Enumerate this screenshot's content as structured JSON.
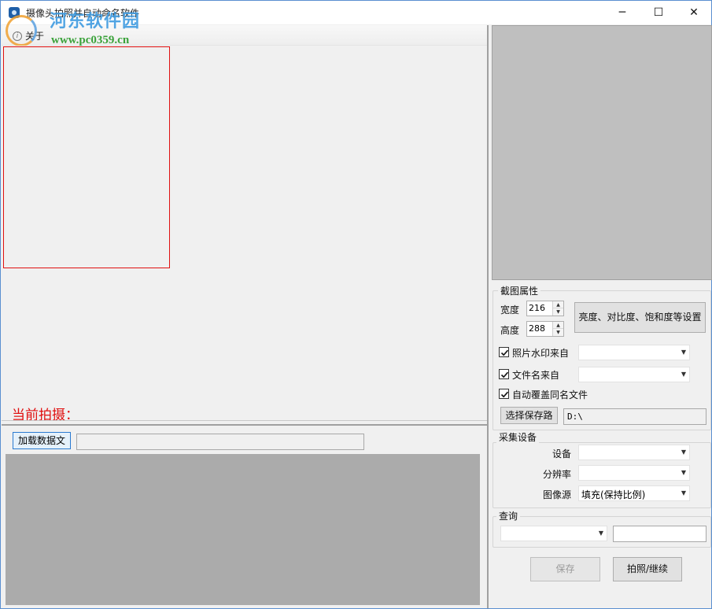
{
  "window": {
    "title": "摄像头拍照并自动命名软件",
    "controls": {
      "minimize": "─",
      "maximize": "☐",
      "close": "✕"
    }
  },
  "watermark": {
    "site_name": "河东软件园",
    "url": "www.pc0359.cn"
  },
  "menu": {
    "items": [
      {
        "label": "关于",
        "icon": "info-icon"
      }
    ]
  },
  "capture": {
    "current_shot_label": "当前拍摄：",
    "frame_color": "#e01010"
  },
  "data_load": {
    "button_label": "加载数据文",
    "path_value": ""
  },
  "crop_props": {
    "group_title": "截图属性",
    "width_label": "宽度",
    "width_value": "216",
    "height_label": "高度",
    "height_value": "288",
    "adjust_button": "亮度、对比度、饱和度等设置",
    "watermark_check": {
      "label": "照片水印来自",
      "checked": true,
      "value": ""
    },
    "filename_check": {
      "label": "文件名来自",
      "checked": true,
      "value": ""
    },
    "overwrite_check": {
      "label": "自动覆盖同名文件",
      "checked": true
    },
    "save_path_button": "选择保存路",
    "save_path_value": "D:\\"
  },
  "capture_device": {
    "group_title": "采集设备",
    "device_label": "设备",
    "device_value": "",
    "resolution_label": "分辨率",
    "resolution_value": "",
    "image_source_label": "图像源",
    "image_source_value": "填充(保持比例)"
  },
  "query": {
    "group_title": "查询",
    "field_value": "",
    "text_value": ""
  },
  "actions": {
    "save_label": "保存",
    "save_enabled": false,
    "capture_label": "拍照/继续"
  },
  "colors": {
    "accent": "#2a7ad0",
    "preview_bg": "#bfbfbf",
    "data_panel_bg": "#ababab",
    "label_red": "#e01010"
  }
}
